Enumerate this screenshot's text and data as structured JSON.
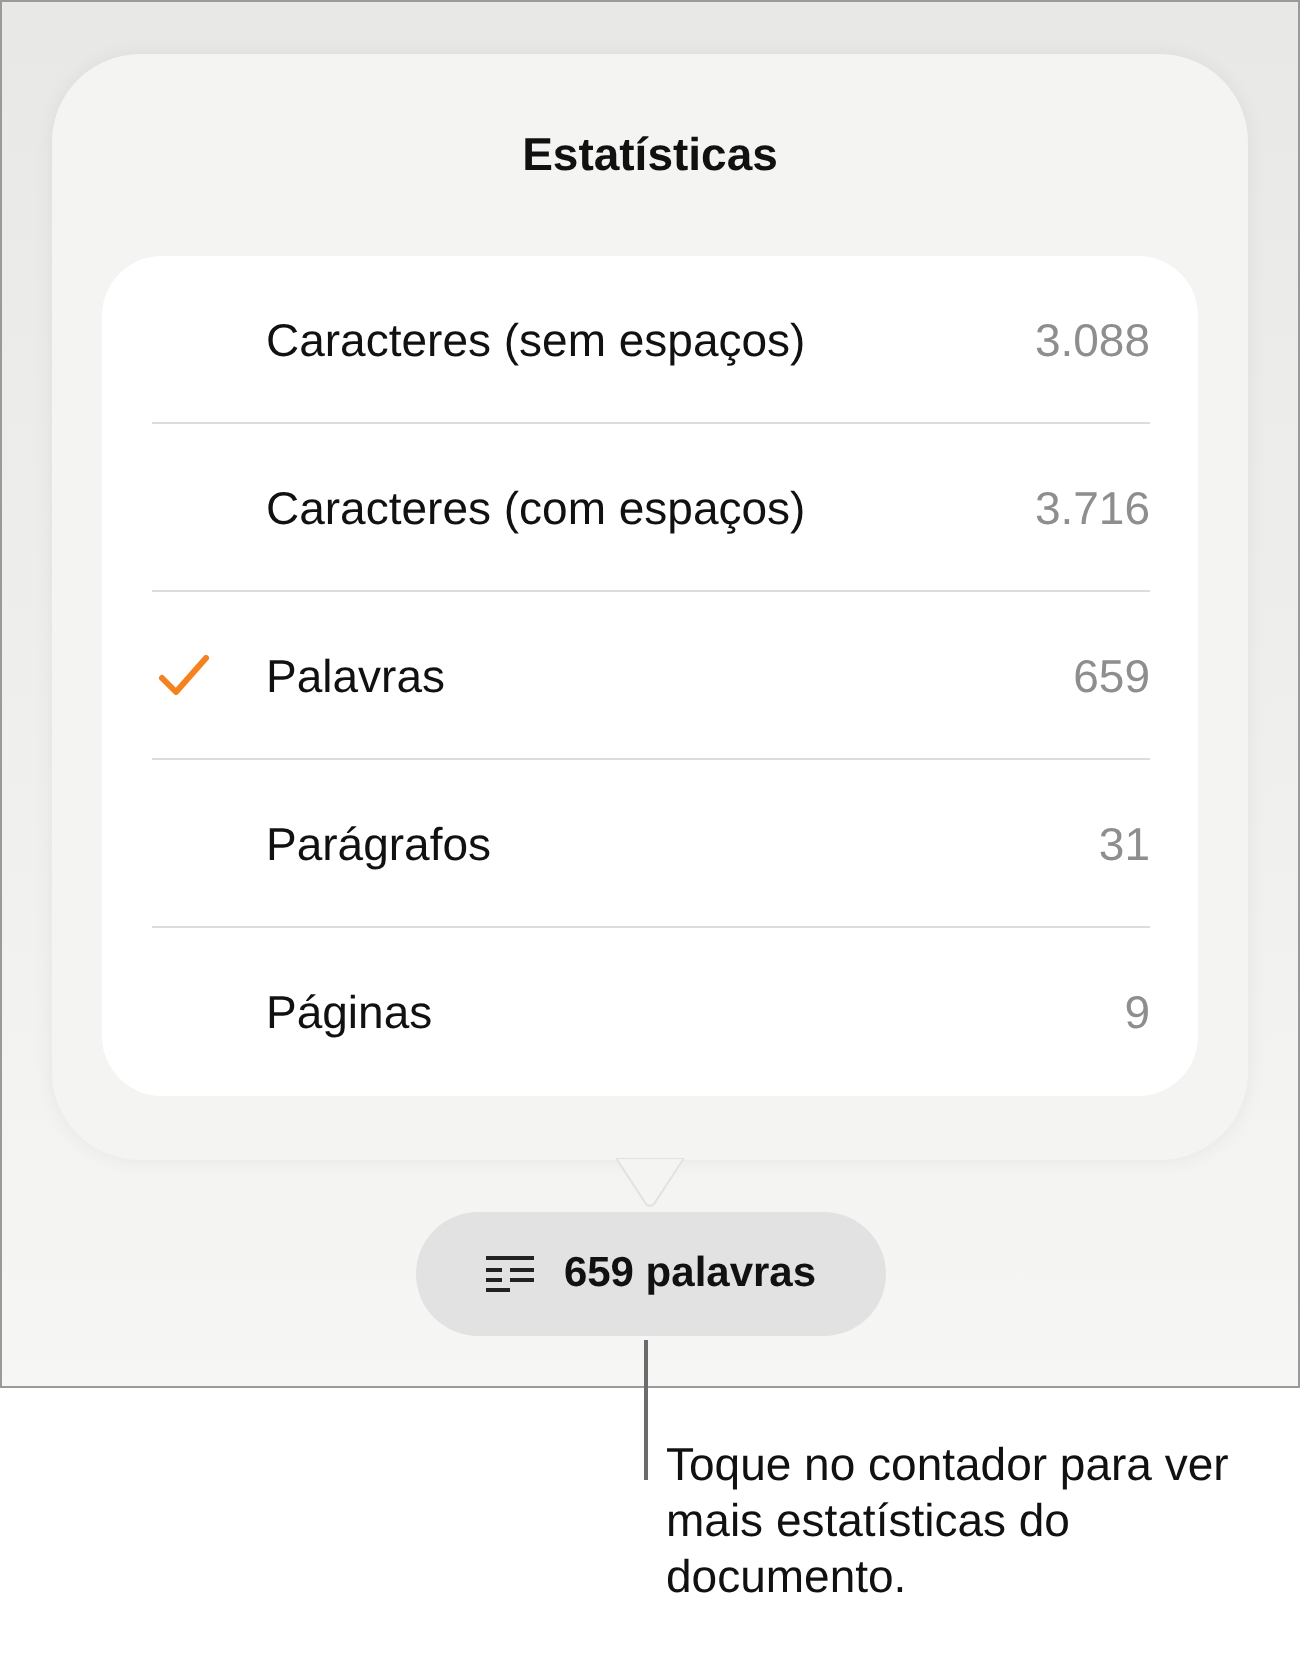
{
  "popover": {
    "title": "Estatísticas",
    "rows": [
      {
        "label": "Caracteres (sem espaços)",
        "value": "3.088",
        "selected": false
      },
      {
        "label": "Caracteres (com espaços)",
        "value": "3.716",
        "selected": false
      },
      {
        "label": "Palavras",
        "value": "659",
        "selected": true
      },
      {
        "label": "Parágrafos",
        "value": "31",
        "selected": false
      },
      {
        "label": "Páginas",
        "value": "9",
        "selected": false
      }
    ]
  },
  "counter_button": {
    "label": "659 palavras"
  },
  "callout": "Toque no contador para ver mais estatísticas do documento."
}
